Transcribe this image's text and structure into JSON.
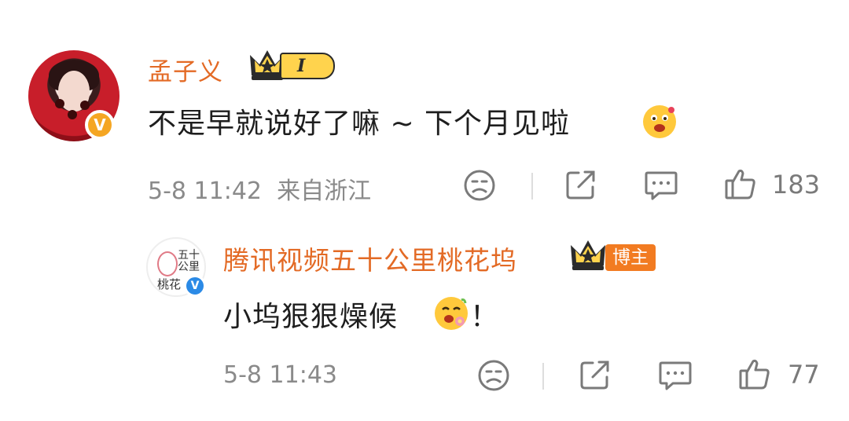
{
  "comments": [
    {
      "author": "孟子义",
      "verified_badge": "V",
      "level": "I",
      "text": "不是早就说好了嘛 ~ 下个月见啦",
      "emoji": "happy-face-emoji",
      "time": "5-8 11:42",
      "location": "来自浙江",
      "likes": "183"
    },
    {
      "author": "腾讯视频五十公里桃花坞",
      "avatar_text_top": "五十\n公里",
      "avatar_text_bottom": "桃花",
      "verified_badge": "V",
      "role_badge": "博主",
      "text": "小坞狠狠燥候",
      "text_end": "！",
      "emoji": "flower-happy-face-emoji",
      "time": "5-8 11:43",
      "likes": "77"
    }
  ],
  "colors": {
    "username": "#e36a25",
    "meta": "#8a8a8a",
    "level_gold": "#ffd34d",
    "role_badge": "#f27b21",
    "verified_orange": "#f5a623",
    "verified_blue": "#2b8ae6"
  }
}
